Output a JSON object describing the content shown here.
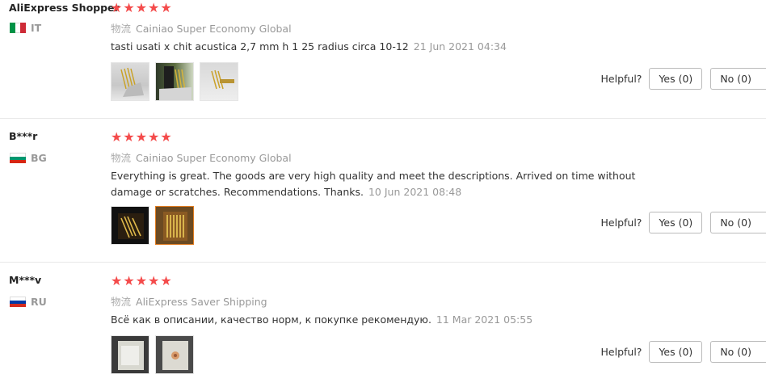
{
  "reviews": [
    {
      "user": "AliExpress Shopper",
      "country_code": "IT",
      "flag_colors": [
        "#009246",
        "#ffffff",
        "#ce2b37"
      ],
      "flag_orientation": "vertical",
      "rating": 5,
      "stars": "★★★★★",
      "logistics_label": "物流",
      "logistics": "Cainiao Super Economy Global",
      "text": "tasti usati x chit acustica 2,7 mm h 1 25 radius circa 10-12",
      "date": "21 Jun 2021 04:34",
      "helpful_label": "Helpful?",
      "yes": "Yes (0)",
      "no": "No (0)"
    },
    {
      "user": "B***r",
      "country_code": "BG",
      "flag_colors": [
        "#ffffff",
        "#00966e",
        "#d62612"
      ],
      "flag_orientation": "horizontal",
      "rating": 5,
      "stars": "★★★★★",
      "logistics_label": "物流",
      "logistics": "Cainiao Super Economy Global",
      "text": "Everything is great. The goods are very high quality and meet the descriptions. Arrived on time without damage or scratches. Recommendations. Thanks.",
      "date": "10 Jun 2021 08:48",
      "helpful_label": "Helpful?",
      "yes": "Yes (0)",
      "no": "No (0)"
    },
    {
      "user": "M***v",
      "country_code": "RU",
      "flag_colors": [
        "#ffffff",
        "#0039a6",
        "#d52b1e"
      ],
      "flag_orientation": "horizontal",
      "rating": 5,
      "stars": "★★★★★",
      "logistics_label": "物流",
      "logistics": "AliExpress Saver Shipping",
      "text": "Всё как в описании, качество норм, к покупке рекомендую.",
      "date": "11 Mar 2021 05:55",
      "helpful_label": "Helpful?",
      "yes": "Yes (0)",
      "no": "No (0)"
    }
  ],
  "colors": {
    "star": "#f44b4b",
    "muted": "#999999",
    "active_thumb_border": "#e07b1e"
  }
}
